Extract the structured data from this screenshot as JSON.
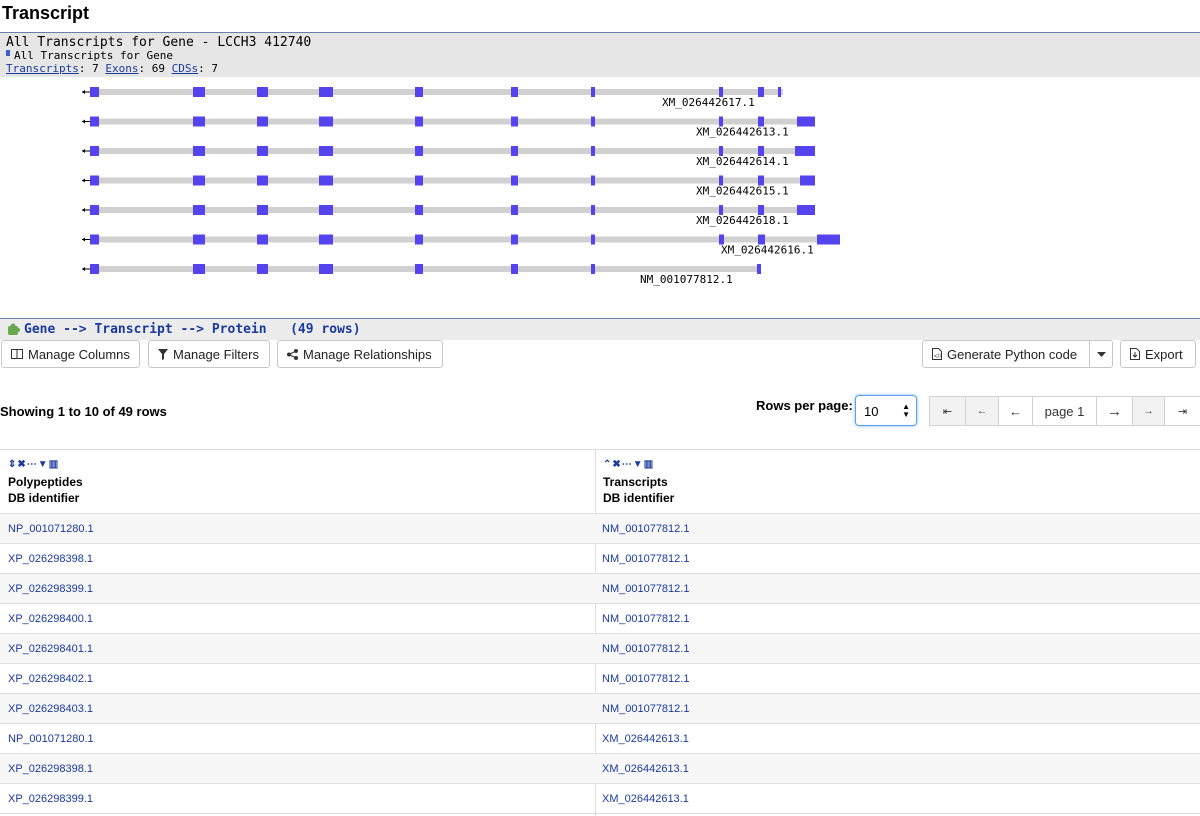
{
  "page_title": "Transcript",
  "gene": {
    "title": "All Transcripts for Gene - LCCH3 412740",
    "subtitle": "All Transcripts for Gene",
    "transcripts_link": "Transcripts",
    "transcripts_count": ": 7",
    "exons_link": "Exons",
    "exons_count": ": 69",
    "cdss_link": "CDSs",
    "cdss_count": ": 7"
  },
  "tracks": [
    {
      "label": "XM_026442617.1"
    },
    {
      "label": "XM_026442613.1"
    },
    {
      "label": "XM_026442614.1"
    },
    {
      "label": "XM_026442615.1"
    },
    {
      "label": "XM_026442618.1"
    },
    {
      "label": "XM_026442616.1"
    },
    {
      "label": "NM_001077812.1"
    }
  ],
  "relationship": {
    "text": "Gene --> Transcript --> Protein   (49 rows)"
  },
  "toolbar": {
    "manage_columns": "Manage Columns",
    "manage_filters": "Manage Filters",
    "manage_relationships": "Manage Relationships",
    "generate_python": "Generate Python code",
    "export": "Export"
  },
  "paging": {
    "showing": "Showing 1 to 10 of 49 rows",
    "rows_per_page_label": "Rows per page:",
    "rows_per_page_value": "10",
    "page_label": "page 1",
    "first": "⇤",
    "prev_small": "←",
    "prev": "←",
    "next": "→",
    "next_small": "→",
    "last": "⇥"
  },
  "table": {
    "columns": [
      {
        "line1": "Polypeptides",
        "line2": "DB identifier"
      },
      {
        "line1": "Transcripts",
        "line2": "DB identifier"
      }
    ],
    "rows": [
      [
        "NP_001071280.1",
        "NM_001077812.1"
      ],
      [
        "XP_026298398.1",
        "NM_001077812.1"
      ],
      [
        "XP_026298399.1",
        "NM_001077812.1"
      ],
      [
        "XP_026298400.1",
        "NM_001077812.1"
      ],
      [
        "XP_026298401.1",
        "NM_001077812.1"
      ],
      [
        "XP_026298402.1",
        "NM_001077812.1"
      ],
      [
        "XP_026298403.1",
        "NM_001077812.1"
      ],
      [
        "NP_001071280.1",
        "XM_026442613.1"
      ],
      [
        "XP_026298398.1",
        "XM_026442613.1"
      ],
      [
        "XP_026298399.1",
        "XM_026442613.1"
      ]
    ]
  },
  "colors": {
    "exon": "#5544ee",
    "intron": "#d0d0d0",
    "link": "#1a3a9e"
  }
}
